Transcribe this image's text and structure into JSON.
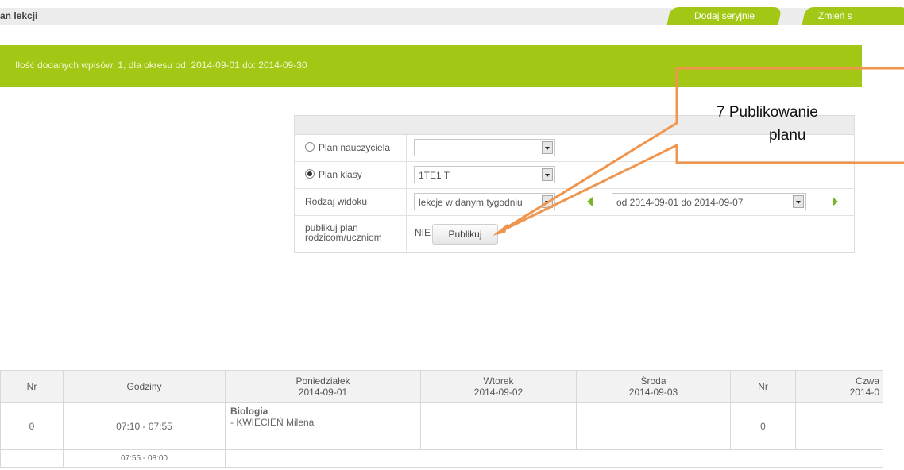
{
  "header": {
    "title": "an lekcji",
    "buttons": [
      "Dodaj seryjnie",
      "Zmień s"
    ]
  },
  "banner": {
    "message": "Ilość dodanych wpisów: 1, dla okresu od: 2014-09-01 do: 2014-09-30"
  },
  "annotation": {
    "line1": "7 Publikowanie",
    "line2": "planu",
    "color": "#f0954e"
  },
  "form": {
    "teacher_label": "Plan nauczyciela",
    "teacher_value": "",
    "class_label": "Plan klasy",
    "class_value": "1TE1 T",
    "view_label": "Rodzaj widoku",
    "view_value": "lekcje w danym tygodniu",
    "week_value": "od 2014-09-01 do 2014-09-07",
    "publish_label_1": "publikuj plan",
    "publish_label_2": "rodzicom/uczniom",
    "publish_status": "NIE",
    "publish_button": "Publikuj"
  },
  "timetable": {
    "headers": [
      {
        "name": "Nr",
        "date": ""
      },
      {
        "name": "Godziny",
        "date": ""
      },
      {
        "name": "Poniedziałek",
        "date": "2014-09-01"
      },
      {
        "name": "Wtorek",
        "date": "2014-09-02"
      },
      {
        "name": "Środa",
        "date": "2014-09-03"
      },
      {
        "name": "Nr",
        "date": ""
      },
      {
        "name": "Czwa",
        "date": "2014-0"
      }
    ],
    "row0": {
      "nr": "0",
      "hours": "07:10 - 07:55",
      "subject": "Biologia",
      "teacher": "- KWIECIEŃ Milena",
      "nr2": "0"
    },
    "break_hours": "07:55 - 08:00"
  },
  "colors": {
    "accent_green": "#a3c715",
    "arrow_green": "#77b62a"
  }
}
